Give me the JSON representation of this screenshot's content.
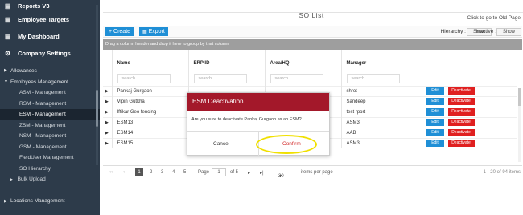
{
  "sidebar": {
    "main_items": [
      {
        "label": "Reports V3",
        "icon": "chart-icon"
      },
      {
        "label": "Employee Targets",
        "icon": "chart-icon"
      },
      {
        "label": "My Dashboard",
        "icon": "chart-icon"
      },
      {
        "label": "Company Settings",
        "icon": "gears-icon"
      }
    ],
    "groups": {
      "allowances": "Allowances",
      "employees_management": "Employees Management",
      "locations_management": "Locations Management"
    },
    "sub_items": [
      "ASM - Management",
      "RSM - Management",
      "ESM - Management",
      "ZSM - Management",
      "NSM - Management",
      "GSM - Management",
      "FieldUser Management",
      "SO Hierarchy"
    ],
    "bulk_upload": "Bulk Upload"
  },
  "page": {
    "title": "SO List",
    "old_page_link": "Click to go to Old Page"
  },
  "toolbar": {
    "create_label": "+ Create",
    "export_label": "Export",
    "hierarchy_label": "Hierarchy :",
    "hierarchy_button": "Show",
    "inactive_label": "Inactive :",
    "inactive_button": "Show"
  },
  "grid": {
    "group_hint": "Drag a column header and drop it here to group by that column",
    "columns": [
      "Name",
      "ERP ID",
      "Area/HQ",
      "Manager"
    ],
    "filter_placeholder": "search..",
    "rows": [
      {
        "name": "Pankaj Gurgaon",
        "erp": "",
        "area": "",
        "manager": "shrot"
      },
      {
        "name": "Vipin Gutkha",
        "erp": "",
        "area": "",
        "manager": "Sandeep"
      },
      {
        "name": "Iftikar Geo fencing",
        "erp": "",
        "area": "",
        "manager": "test rport"
      },
      {
        "name": "ESM13",
        "erp": "",
        "area": "",
        "manager": "ASM3"
      },
      {
        "name": "ESM14",
        "erp": "",
        "area": "",
        "manager": "AAB"
      },
      {
        "name": "ESM15",
        "erp": "",
        "area": "",
        "manager": "ASM3"
      }
    ],
    "edit_label": "Edit",
    "deactivate_label": "Deactivate"
  },
  "pager": {
    "pages": [
      "1",
      "2",
      "3",
      "4",
      "5"
    ],
    "page_label": "Page",
    "page_value": "1",
    "of_label": "of 5",
    "page_size": "20",
    "items_per_page": "items per page",
    "summary": "1 - 20 of 94 items"
  },
  "modal": {
    "title": "ESM Deactivation",
    "message": "Are you sure to deactivate Pankaj Gurgaon as an ESM?",
    "cancel": "Cancel",
    "confirm": "Confirm"
  },
  "colors": {
    "sidebar_bg": "#2d3b4a",
    "accent_blue": "#1f8fd6",
    "danger_red": "#e02020",
    "modal_header": "#a3182a",
    "highlight": "#f0e000"
  }
}
